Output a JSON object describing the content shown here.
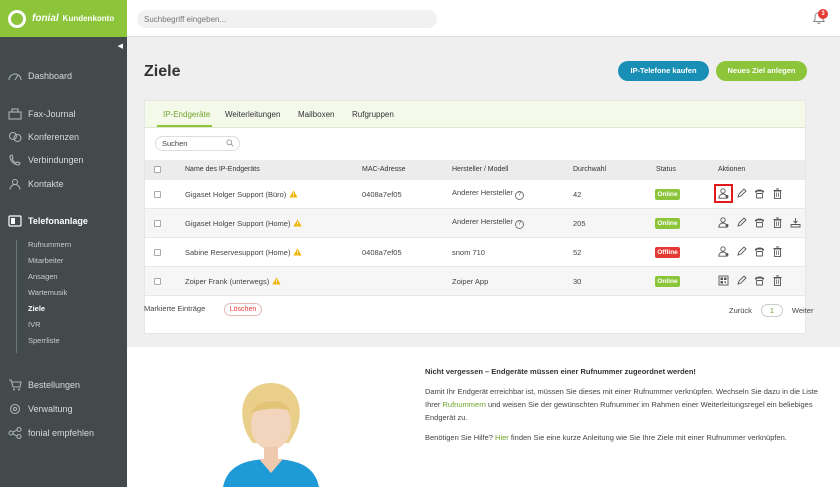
{
  "brand": {
    "name": "fonial",
    "sub": "Kundenkonto"
  },
  "topbar": {
    "search_placeholder": "Suchbegriff eingeben...",
    "notifications": "3"
  },
  "sidebar": {
    "items": [
      {
        "label": "Dashboard",
        "icon": "dashboard-icon"
      },
      {
        "label": "Fax-Journal",
        "icon": "fax-icon"
      },
      {
        "label": "Konferenzen",
        "icon": "conference-icon"
      },
      {
        "label": "Verbindungen",
        "icon": "phone-icon"
      },
      {
        "label": "Kontakte",
        "icon": "contacts-icon"
      },
      {
        "label": "Telefonanlage",
        "icon": "pbx-icon"
      },
      {
        "label": "Bestellungen",
        "icon": "cart-icon"
      },
      {
        "label": "Verwaltung",
        "icon": "gear-icon"
      },
      {
        "label": "fonial empfehlen",
        "icon": "share-icon"
      }
    ],
    "subitems": [
      "Rufnummern",
      "Mitarbeiter",
      "Ansagen",
      "Wartemusik",
      "Ziele",
      "IVR",
      "Sperrliste"
    ]
  },
  "main": {
    "title": "Ziele",
    "btn_ip": "IP-Telefone kaufen",
    "btn_new": "Neues Ziel anlegen"
  },
  "tabs": [
    "IP-Endgeräte",
    "Weiterleitungen",
    "Mailboxen",
    "Rufgruppen"
  ],
  "table": {
    "search_placeholder": "Suchen",
    "headers": [
      "Name des IP-Endgeräts",
      "MAC-Adresse",
      "Hersteller / Modell",
      "Durchwahl",
      "Status",
      "Aktionen"
    ],
    "rows": [
      {
        "name": "Gigaset Holger Support (Büro)",
        "mac": "0408a7ef05",
        "model": "Anderer Hersteller",
        "ext": "42",
        "status": "Online"
      },
      {
        "name": "Gigaset Holger Support (Home)",
        "mac": "",
        "model": "Anderer Hersteller",
        "ext": "205",
        "status": "Online"
      },
      {
        "name": "Sabine Reservesupport (Home)",
        "mac": "0408a7ef05",
        "model": "snom 710",
        "ext": "52",
        "status": "Offline"
      },
      {
        "name": "Zoiper Frank (unterwegs)",
        "mac": "",
        "model": "Zoiper App",
        "ext": "30",
        "status": "Online"
      }
    ],
    "marked_label": "Markierte Einträge",
    "delete_label": "Löschen",
    "prev": "Zurück",
    "page": "1",
    "next": "Weiter"
  },
  "info": {
    "title": "Nicht vergessen – Endgeräte müssen einer Rufnummer zugeordnet werden!",
    "p1_a": "Damit Ihr Endgerät erreichbar ist, müssen Sie dieses mit einer Rufnummer verknüpfen. Wechseln Sie dazu in die Liste Ihrer ",
    "p1_link": "Rufnummern",
    "p1_b": " und weisen Sie der gewünschten Rufnummer im Rahmen einer Weiterleitungsregel ein beliebiges Endgerät zu.",
    "p2_a": "Benötigen Sie Hilfe? ",
    "p2_link": "Hier",
    "p2_b": " finden Sie eine kurze Anleitung wie Sie Ihre Ziele mit einer Rufnummer verknüpfen."
  },
  "colors": {
    "brand": "#8cc43a",
    "sidebar": "#424a4c",
    "blue": "#1a8fb6",
    "offline": "#e53935"
  }
}
